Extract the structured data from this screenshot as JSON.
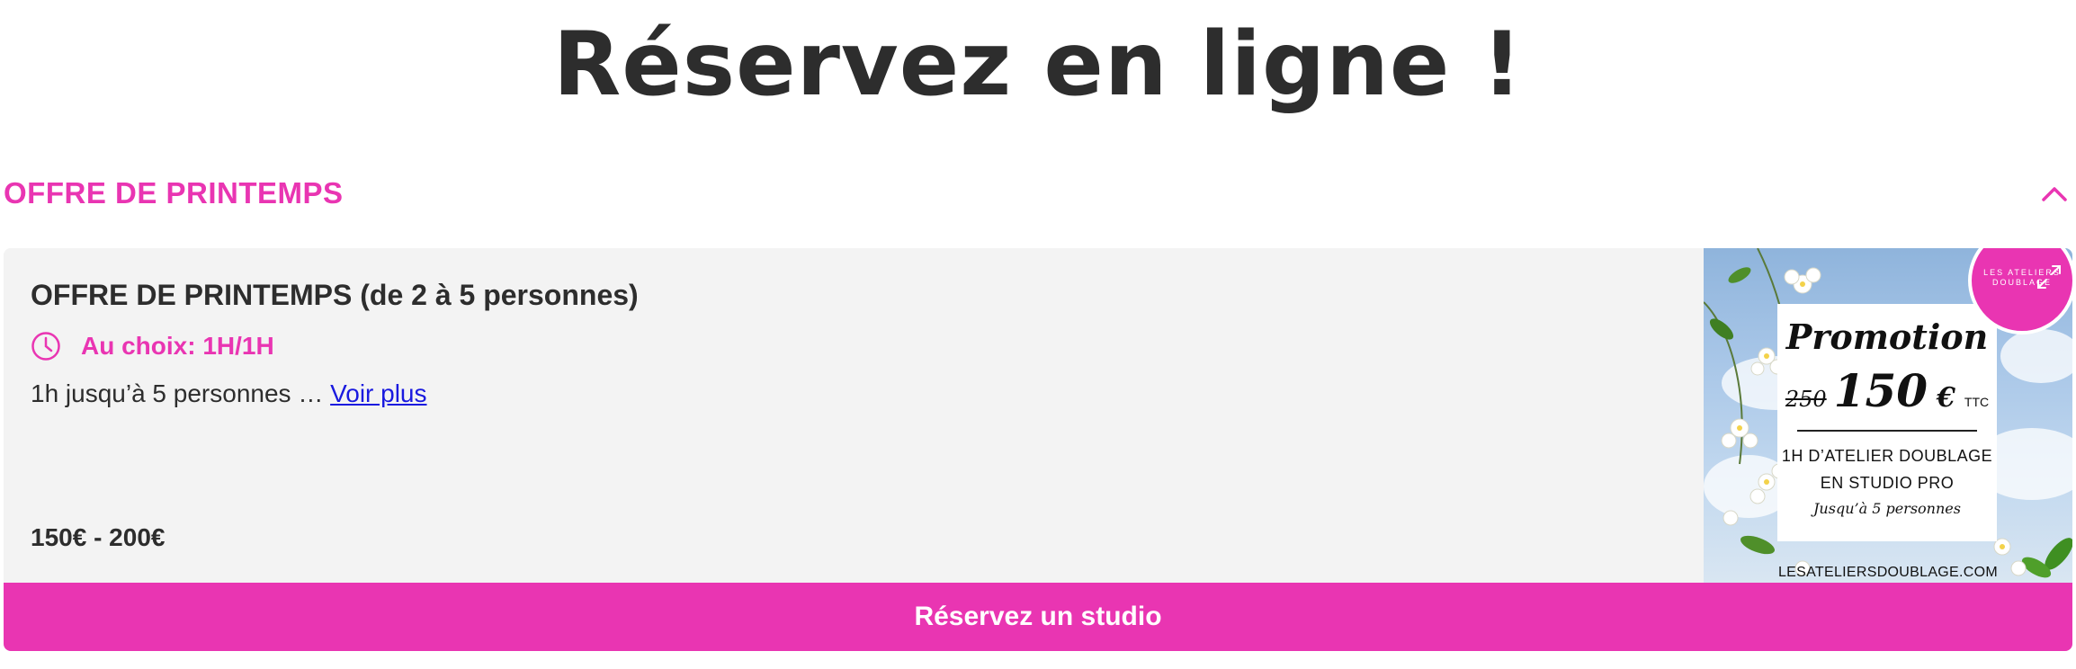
{
  "page": {
    "title": "Réservez en ligne !"
  },
  "section": {
    "title": "OFFRE DE PRINTEMPS",
    "toggle_icon": "chevron-up-icon"
  },
  "offer": {
    "title": "OFFRE DE PRINTEMPS (de 2 à 5 personnes)",
    "duration_icon": "clock-icon",
    "duration": "Au choix: 1H/1H",
    "description": "1h jusqu’à 5 personnes … ",
    "see_more": "Voir plus",
    "price": "150€ - 200€",
    "image": {
      "promo_title": "Promotion",
      "old_price": "250",
      "new_price": "150",
      "currency": "€",
      "tax_label": "TTC",
      "line1": "1H D’ATELIER DOUBLAGE",
      "line2": "EN STUDIO PRO",
      "line3": "Jusqu’à 5 personnes",
      "website": "LESATELIERSDOUBLAGE.COM",
      "logo_text": "LES ATELIERS DOUBLAGE",
      "expand_icon": "expand-icon"
    },
    "cta": "Réservez un studio"
  },
  "colors": {
    "accent": "#e935b2",
    "link": "#1a1adf",
    "text": "#2d2d2d",
    "card_bg": "#f3f3f3"
  }
}
